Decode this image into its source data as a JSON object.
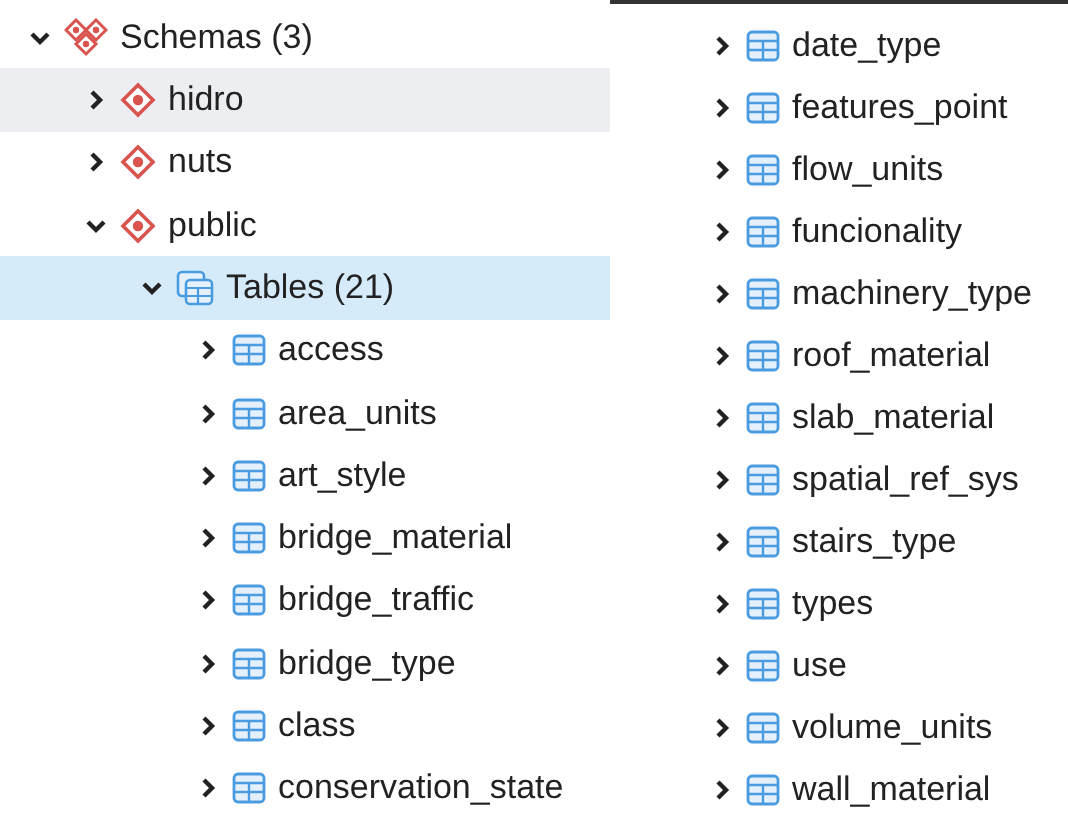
{
  "tree": [
    {
      "label": "Schemas (3)",
      "kind": "schemas",
      "expanded": true,
      "selected": false,
      "hovered": false,
      "children": [
        {
          "label": "hidro",
          "kind": "schema",
          "expanded": false,
          "selected": false,
          "hovered": true
        },
        {
          "label": "nuts",
          "kind": "schema",
          "expanded": false,
          "selected": false,
          "hovered": false
        },
        {
          "label": "public",
          "kind": "schema",
          "expanded": true,
          "selected": false,
          "hovered": false,
          "children": [
            {
              "label": "Tables (21)",
              "kind": "tables",
              "expanded": true,
              "selected": true,
              "hovered": false,
              "children": [
                {
                  "label": "access",
                  "kind": "table",
                  "expanded": false,
                  "selected": false,
                  "hovered": false
                },
                {
                  "label": "area_units",
                  "kind": "table",
                  "expanded": false,
                  "selected": false,
                  "hovered": false
                },
                {
                  "label": "art_style",
                  "kind": "table",
                  "expanded": false,
                  "selected": false,
                  "hovered": false
                },
                {
                  "label": "bridge_material",
                  "kind": "table",
                  "expanded": false,
                  "selected": false,
                  "hovered": false
                },
                {
                  "label": "bridge_traffic",
                  "kind": "table",
                  "expanded": false,
                  "selected": false,
                  "hovered": false
                },
                {
                  "label": "bridge_type",
                  "kind": "table",
                  "expanded": false,
                  "selected": false,
                  "hovered": false
                },
                {
                  "label": "class",
                  "kind": "table",
                  "expanded": false,
                  "selected": false,
                  "hovered": false
                },
                {
                  "label": "conservation_state",
                  "kind": "table",
                  "expanded": false,
                  "selected": false,
                  "hovered": false
                }
              ]
            }
          ]
        }
      ]
    }
  ],
  "continued_tables": [
    {
      "label": "date_type",
      "expanded": false
    },
    {
      "label": "features_point",
      "expanded": false
    },
    {
      "label": "flow_units",
      "expanded": false
    },
    {
      "label": "funcionality",
      "expanded": false
    },
    {
      "label": "machinery_type",
      "expanded": false
    },
    {
      "label": "roof_material",
      "expanded": false
    },
    {
      "label": "slab_material",
      "expanded": false
    },
    {
      "label": "spatial_ref_sys",
      "expanded": false
    },
    {
      "label": "stairs_type",
      "expanded": false
    },
    {
      "label": "types",
      "expanded": false
    },
    {
      "label": "use",
      "expanded": false
    },
    {
      "label": "volume_units",
      "expanded": false
    },
    {
      "label": "wall_material",
      "expanded": false
    }
  ]
}
